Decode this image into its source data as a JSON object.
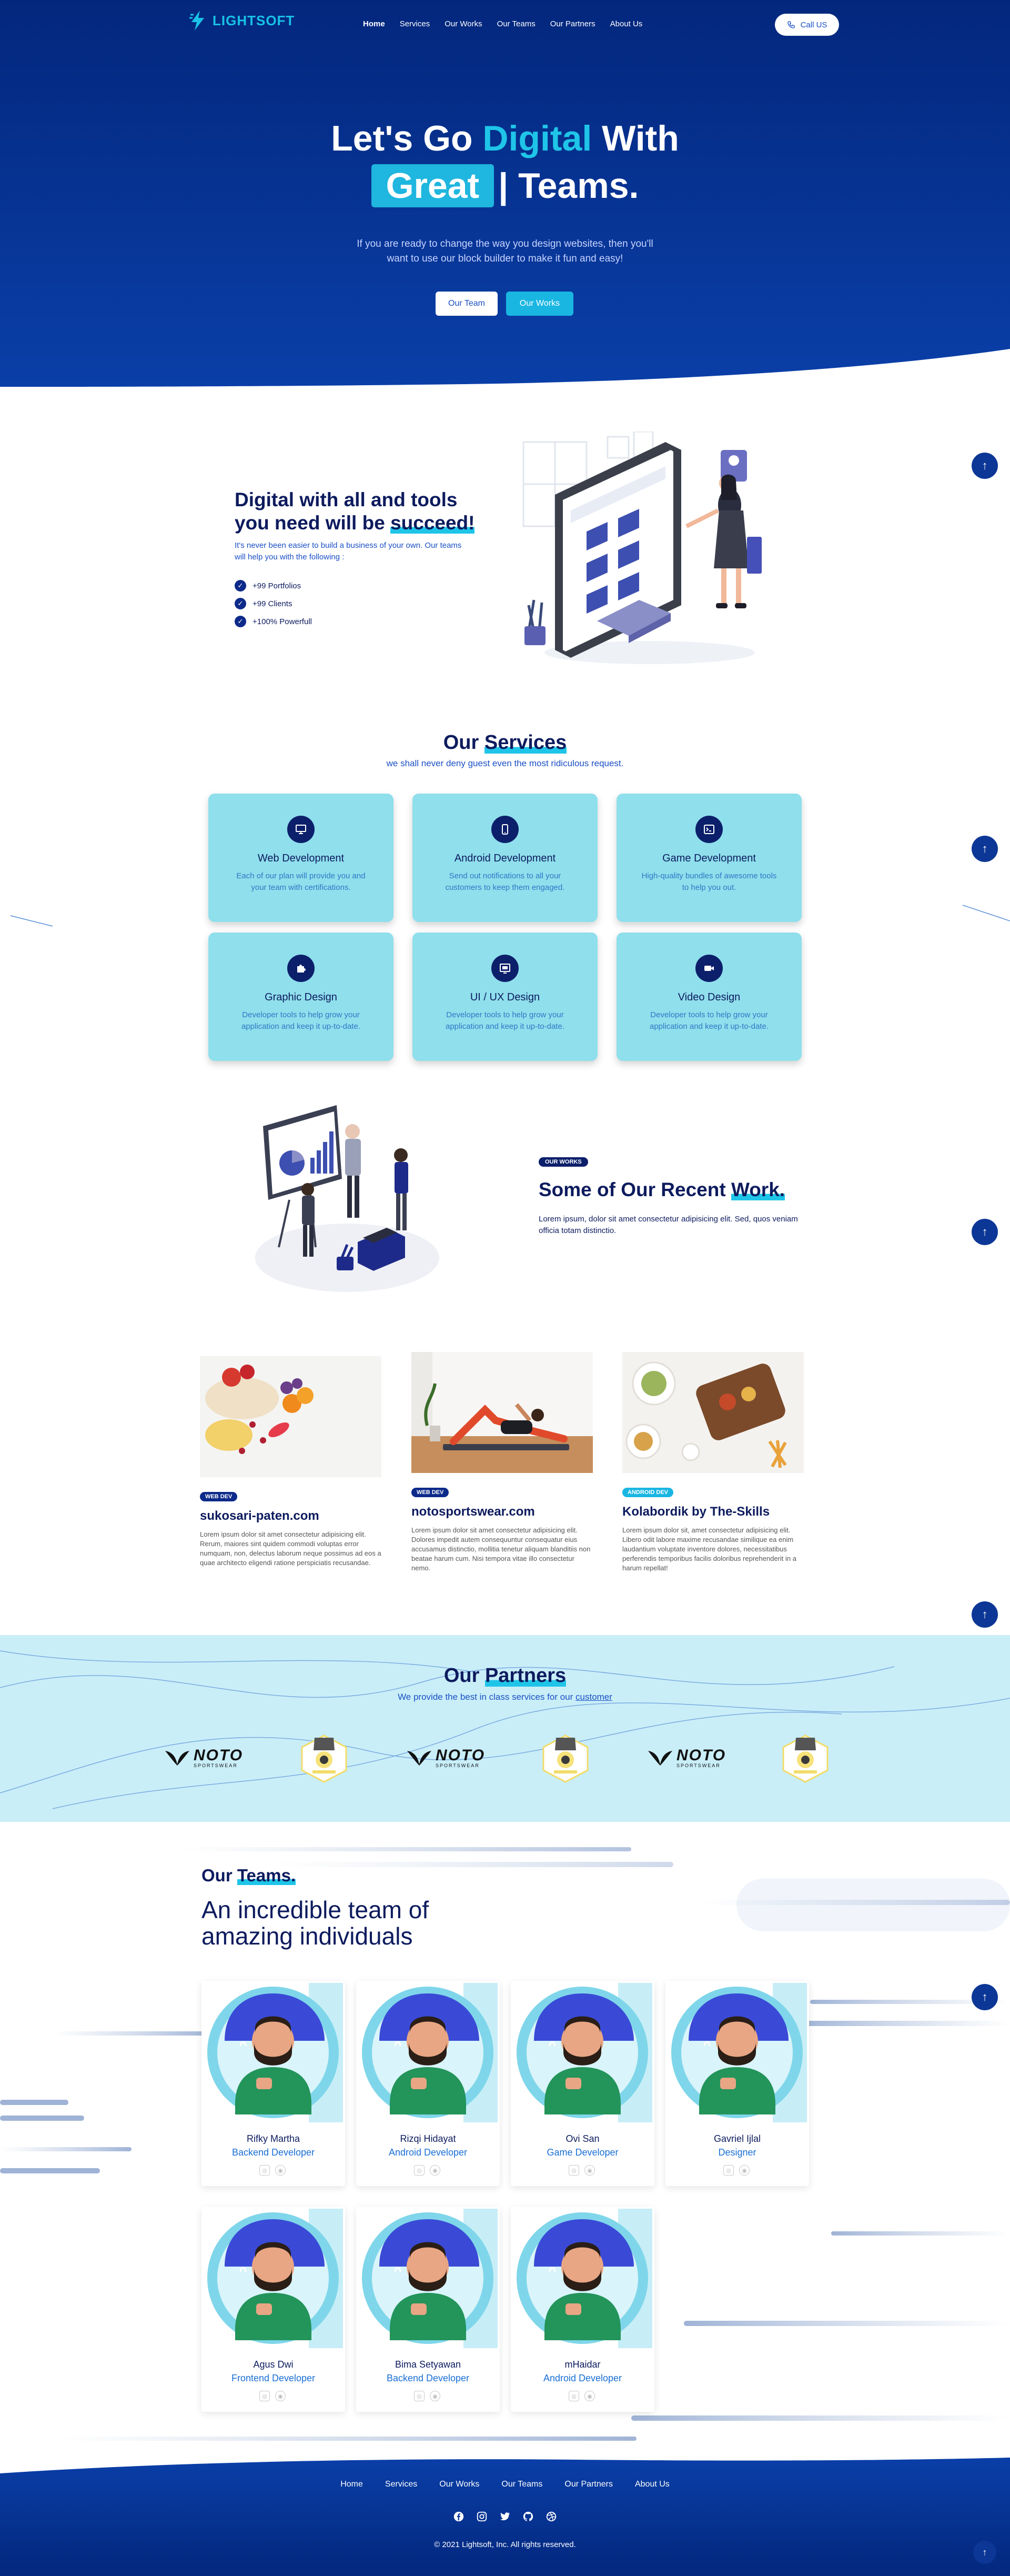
{
  "nav": {
    "logo": "LIGHTSOFT",
    "links": [
      "Home",
      "Services",
      "Our Works",
      "Our Teams",
      "Our Partners",
      "About Us"
    ],
    "call_label": "Call US"
  },
  "hero": {
    "title_a": "Let's Go ",
    "title_hl": "Digital",
    "title_b": " With",
    "great": "Great",
    "teams": "| Teams.",
    "subtitle": "If you are ready to change the way you design websites, then you'll want to use our block builder to make it fun and easy!",
    "btn_team": "Our Team",
    "btn_works": "Our Works"
  },
  "digital": {
    "title_a": "Digital with all and tools you need will be ",
    "title_hl": "succeed!",
    "desc": "It's never been easier to build a business of your own. Our teams will help you with the following :",
    "checks": [
      "+99 Portfolios",
      "+99 Clients",
      "+100% Powerfull"
    ]
  },
  "services": {
    "title_a": "Our ",
    "title_hl": "Services",
    "subtitle": "we shall never deny guest even the most ridiculous request.",
    "items": [
      {
        "title": "Web Development",
        "desc": "Each of our plan will provide you and your team with certifications.",
        "icon": "monitor-icon"
      },
      {
        "title": "Android Development",
        "desc": "Send out notifications to all your customers to keep them engaged.",
        "icon": "smartphone-icon"
      },
      {
        "title": "Game Development",
        "desc": "High-quality bundles of awesome tools to help you out.",
        "icon": "terminal-icon"
      },
      {
        "title": "Graphic Design",
        "desc": "Developer tools to help grow your application and keep it up-to-date.",
        "icon": "puzzle-icon"
      },
      {
        "title": "UI / UX Design",
        "desc": "Developer tools to help grow your application and keep it up-to-date.",
        "icon": "layout-icon"
      },
      {
        "title": "Video Design",
        "desc": "Developer tools to help grow your application and keep it up-to-date.",
        "icon": "video-icon"
      }
    ]
  },
  "works": {
    "badge": "OUR WORKS",
    "title_a": "Some of Our Recent ",
    "title_hl": "Work.",
    "desc": "Lorem ipsum, dolor sit amet consectetur adipisicing elit. Sed, quos veniam officia totam distinctio.",
    "items": [
      {
        "badge": "WEB DEV",
        "title": "sukosari-paten.com",
        "desc": "Lorem ipsum dolor sit amet consectetur adipisicing elit. Rerum, maiores sint quidem commodi voluptas error numquam, non, delectus laborum neque possimus ad eos a quae architecto eligendi ratione perspiciatis recusandae."
      },
      {
        "badge": "WEB DEV",
        "title": "notosportswear.com",
        "desc": "Lorem ipsum dolor sit amet consectetur adipisicing elit. Dolores impedit autem consequuntur consequatur eius accusamus distinctio, mollitia tenetur aliquam blanditiis non beatae harum cum. Nisi tempora vitae illo consectetur nemo."
      },
      {
        "badge": "ANDROID DEV",
        "title": "Kolabordik by The-Skills",
        "desc": "Lorem ipsum dolor sit, amet consectetur adipisicing elit. Libero odit labore maxime recusandae similique ea enim laudantium voluptate inventore dolores, necessitatibus perferendis temporibus facilis doloribus reprehenderit in a harum repellat!"
      }
    ]
  },
  "partners": {
    "title_a": "Our ",
    "title_hl": "Partners",
    "subtitle_a": "We provide the best in class services for our ",
    "subtitle_hl": "customer",
    "logo_text": "NOTO",
    "logo_sub": "SPORTSWEAR"
  },
  "teams": {
    "title_a": "Our ",
    "title_hl": "Teams.",
    "headline": "An incredible team of amazing individuals",
    "members": [
      {
        "name": "Rifky Martha",
        "role": "Backend Developer"
      },
      {
        "name": "Rizqi Hidayat",
        "role": "Android Developer"
      },
      {
        "name": "Ovi San",
        "role": "Game Developer"
      },
      {
        "name": "Gavriel Ijlal",
        "role": "Designer"
      },
      {
        "name": "Agus Dwi",
        "role": "Frontend Developer"
      },
      {
        "name": "Bima Setyawan",
        "role": "Backend Developer"
      },
      {
        "name": "mHaidar",
        "role": "Android Developer"
      }
    ]
  },
  "footer": {
    "links": [
      "Home",
      "Services",
      "Our Works",
      "Our Teams",
      "Our Partners",
      "About Us"
    ],
    "copyright": "© 2021 Lightsoft, Inc. All rights reserved."
  },
  "colors": {
    "navy": "#0d1b5e",
    "accent": "#1fc5e8",
    "hero": "#03277d",
    "card": "#8fdfec"
  }
}
